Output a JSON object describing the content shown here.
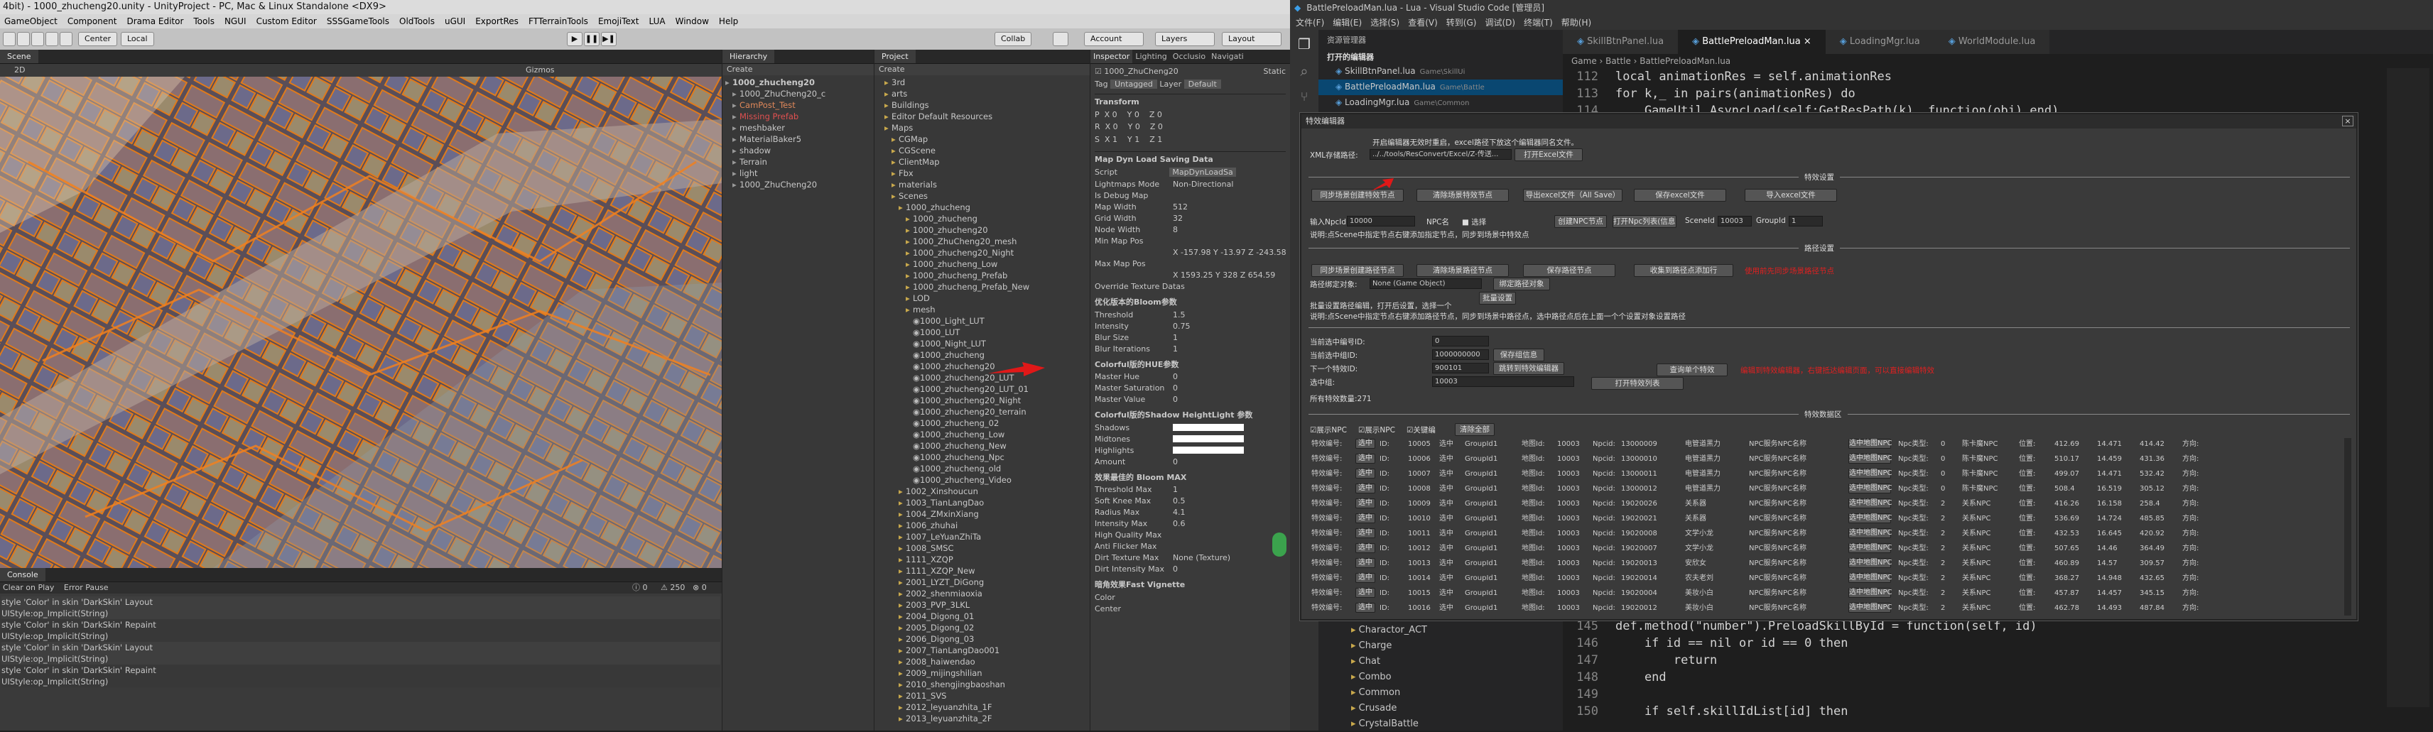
{
  "unity": {
    "title": "4bit) - 1000_zhucheng20.unity - UnityProject - PC, Mac & Linux Standalone <DX9>",
    "menu": [
      "GameObject",
      "Component",
      "Drama Editor",
      "Tools",
      "NGUI",
      "Custom Editor",
      "SSSGameTools",
      "OldTools",
      "uGUI",
      "ExportRes",
      "FTTerrainTools",
      "EmojiText",
      "LUA",
      "Window",
      "Help"
    ],
    "toolbar": {
      "center": "Center",
      "local": "Local",
      "collab": "Collab",
      "account": "Account",
      "layers": "Layers",
      "layout": "Layout"
    },
    "scene": {
      "tab": "Scene",
      "mode": "2D",
      "gizmos": "Gizmos"
    },
    "hierarchy": {
      "tab": "Hierarchy",
      "create": "Create",
      "items": [
        {
          "t": "1000_zhucheng20",
          "d": 0,
          "b": true
        },
        {
          "t": "1000_ZhuCheng20_c",
          "d": 1
        },
        {
          "t": "CamPost_Test",
          "d": 1,
          "c": "#e0885a"
        },
        {
          "t": "Missing Prefab",
          "d": 1,
          "c": "#e05050"
        },
        {
          "t": "meshbaker",
          "d": 1
        },
        {
          "t": "MaterialBaker5",
          "d": 1
        },
        {
          "t": "shadow",
          "d": 1
        },
        {
          "t": "Terrain",
          "d": 1
        },
        {
          "t": "light",
          "d": 1
        },
        {
          "t": "1000_ZhuCheng20",
          "d": 1
        }
      ]
    },
    "project": {
      "tab": "Project",
      "create": "Create",
      "items": [
        {
          "t": "3rd",
          "d": 1
        },
        {
          "t": "arts",
          "d": 1
        },
        {
          "t": "Buildings",
          "d": 1
        },
        {
          "t": "Editor Default Resources",
          "d": 1
        },
        {
          "t": "Maps",
          "d": 1
        },
        {
          "t": "CGMap",
          "d": 2
        },
        {
          "t": "CGScene",
          "d": 2
        },
        {
          "t": "ClientMap",
          "d": 2
        },
        {
          "t": "Fbx",
          "d": 2
        },
        {
          "t": "materials",
          "d": 2
        },
        {
          "t": "Scenes",
          "d": 2
        },
        {
          "t": "1000_zhucheng",
          "d": 3
        },
        {
          "t": "1000_zhucheng",
          "d": 4
        },
        {
          "t": "1000_zhucheng20",
          "d": 4
        },
        {
          "t": "1000_ZhuCheng20_mesh",
          "d": 4
        },
        {
          "t": "1000_zhucheng20_Night",
          "d": 4
        },
        {
          "t": "1000_zhucheng_Low",
          "d": 4
        },
        {
          "t": "1000_zhucheng_Prefab",
          "d": 4
        },
        {
          "t": "1000_zhucheng_Prefab_New",
          "d": 4
        },
        {
          "t": "LOD",
          "d": 4
        },
        {
          "t": "mesh",
          "d": 4
        },
        {
          "t": "1000_Light_LUT",
          "d": 5
        },
        {
          "t": "1000_LUT",
          "d": 5
        },
        {
          "t": "1000_Night_LUT",
          "d": 5
        },
        {
          "t": "1000_zhucheng",
          "d": 5
        },
        {
          "t": "1000_zhucheng20",
          "d": 5
        },
        {
          "t": "1000_zhucheng20_LUT",
          "d": 5
        },
        {
          "t": "1000_zhucheng20_LUT_01",
          "d": 5
        },
        {
          "t": "1000_zhucheng20_Night",
          "d": 5
        },
        {
          "t": "1000_zhucheng20_terrain",
          "d": 5
        },
        {
          "t": "1000_zhucheng_02",
          "d": 5
        },
        {
          "t": "1000_zhucheng_Low",
          "d": 5
        },
        {
          "t": "1000_zhucheng_New",
          "d": 5
        },
        {
          "t": "1000_zhucheng_Npc",
          "d": 5
        },
        {
          "t": "1000_zhucheng_old",
          "d": 5
        },
        {
          "t": "1000_zhucheng_Video",
          "d": 5
        },
        {
          "t": "1002_Xinshoucun",
          "d": 3
        },
        {
          "t": "1003_TianLangDao",
          "d": 3
        },
        {
          "t": "1004_ZMxinXiang",
          "d": 3
        },
        {
          "t": "1006_zhuhai",
          "d": 3
        },
        {
          "t": "1007_LeYuanZhiTa",
          "d": 3
        },
        {
          "t": "1008_SMSC",
          "d": 3
        },
        {
          "t": "1111_XZQP",
          "d": 3
        },
        {
          "t": "1111_XZQP_New",
          "d": 3
        },
        {
          "t": "2001_LYZT_DiGong",
          "d": 3
        },
        {
          "t": "2002_shenmiaoxia",
          "d": 3
        },
        {
          "t": "2003_PVP_3LKL",
          "d": 3
        },
        {
          "t": "2004_Digong_01",
          "d": 3
        },
        {
          "t": "2005_Digong_02",
          "d": 3
        },
        {
          "t": "2006_Digong_03",
          "d": 3
        },
        {
          "t": "2007_TianLangDao001",
          "d": 3
        },
        {
          "t": "2008_haiwendao",
          "d": 3
        },
        {
          "t": "2009_mijingshilian",
          "d": 3
        },
        {
          "t": "2010_shengjingbaoshan",
          "d": 3
        },
        {
          "t": "2011_SVS",
          "d": 3
        },
        {
          "t": "2012_leyuanzhita_1F",
          "d": 3
        },
        {
          "t": "2013_leyuanzhita_2F",
          "d": 3
        }
      ]
    },
    "inspector": {
      "tabs": [
        "Inspector",
        "Lighting",
        "Occlusio",
        "Navigati"
      ],
      "obj": "1000_ZhuCheng20",
      "static": "Static",
      "tag": "Untagged",
      "layer": "Default",
      "transform": "Transform",
      "pos": [
        "0",
        "0",
        "0"
      ],
      "rot": [
        "0",
        "0",
        "0"
      ],
      "scl": [
        "1",
        "1",
        "1"
      ],
      "mapdyn": "Map Dyn Load Saving Data",
      "script": "MapDynLoadSa",
      "rows": [
        [
          "Lightmaps Mode",
          "Non-Directional"
        ],
        [
          "Is Debug Map",
          ""
        ],
        [
          "Map Width",
          "512"
        ],
        [
          "Grid Width",
          "32"
        ],
        [
          "Node Width",
          "8"
        ],
        [
          "Min Map Pos",
          ""
        ],
        [
          "",
          "X -157.98   Y -13.97   Z -243.58"
        ],
        [
          "Max Map Pos",
          ""
        ],
        [
          "",
          "X 1593.25   Y 328   Z 654.59"
        ],
        [
          "Override Texture Datas",
          ""
        ]
      ],
      "bloom_title": "优化版本的Bloom参数",
      "bloom": [
        [
          "Threshold",
          "1.5"
        ],
        [
          "Intensity",
          "0.75"
        ],
        [
          "Blur Size",
          "1"
        ],
        [
          "Blur Iterations",
          "1"
        ]
      ],
      "hue_title": "Colorful版的HUE参数",
      "hue": [
        [
          "Master Hue",
          "0"
        ],
        [
          "Master Saturation",
          "0"
        ],
        [
          "Master Value",
          "0"
        ]
      ],
      "shadow_title": "Colorful版的Shadow HeightLight 参数",
      "shadow": [
        [
          "Shadows",
          ""
        ],
        [
          "Midtones",
          ""
        ],
        [
          "Highlights",
          ""
        ],
        [
          "Amount",
          "0"
        ]
      ],
      "bmax_title": "效果最佳的 Bloom MAX",
      "bmax": [
        [
          "Threshold Max",
          "1"
        ],
        [
          "Soft Knee Max",
          "0.5"
        ],
        [
          "Radius Max",
          "4.1"
        ],
        [
          "Intensity Max",
          "0.6"
        ],
        [
          "High Quality Max",
          ""
        ],
        [
          "Anti Flicker Max",
          ""
        ],
        [
          "Dirt Texture Max",
          "None (Texture)"
        ],
        [
          "Dirt Intensity Max",
          "0"
        ]
      ],
      "vig_title": "暗角效果Fast Vignette",
      "vig": [
        [
          "Color",
          ""
        ],
        [
          "Center",
          ""
        ]
      ]
    },
    "console": {
      "tab": "Console",
      "buttons": [
        "Clear on Play",
        "Error Pause"
      ],
      "counts": [
        "0",
        "250",
        "0"
      ],
      "lines": [
        "style 'Color' in skin 'DarkSkin' Layout",
        "UIStyle:op_Implicit(String)",
        "style 'Color' in skin 'DarkSkin' Repaint",
        "UIStyle:op_Implicit(String)",
        "style 'Color' in skin 'DarkSkin' Layout",
        "UIStyle:op_Implicit(String)",
        "style 'Color' in skin 'DarkSkin' Repaint",
        "UIStyle:op_Implicit(String)"
      ]
    }
  },
  "vscode": {
    "title": "BattlePreloadMan.lua - Lua - Visual Studio Code [管理员]",
    "menu": [
      "文件(F)",
      "编辑(E)",
      "选择(S)",
      "查看(V)",
      "转到(G)",
      "调试(D)",
      "终端(T)",
      "帮助(H)"
    ],
    "explorer": "资源管理器",
    "open_editors": "打开的编辑器",
    "open_files": [
      {
        "n": "SkillBtnPanel.lua",
        "p": "Game\\SkillUi"
      },
      {
        "n": "BattlePreloadMan.lua",
        "p": "Game\\Battle"
      },
      {
        "n": "LoadingMgr.lua",
        "p": "Game\\Common"
      }
    ],
    "tabs": [
      "SkillBtnPanel.lua",
      "BattlePreloadMan.lua",
      "LoadingMgr.lua",
      "WorldModule.lua"
    ],
    "breadcrumb": "Game › Battle › BattlePreloadMan.lua",
    "folders": [
      "Charactor_ACT",
      "Charge",
      "Chat",
      "Combo",
      "Common",
      "Crusade",
      "CrystalBattle"
    ],
    "code_top": [
      [
        "112",
        "local animationRes = self.animationRes"
      ],
      [
        "113",
        "for k,_ in pairs(animationRes) do"
      ],
      [
        "114",
        "    GameUtil.AsyncLoad(self:GetResPath(k), function(obj) end)"
      ]
    ],
    "code_bottom": [
      [
        "145",
        "def.method(\"number\").PreloadSkillById = function(self, id)"
      ],
      [
        "146",
        "    if id == nil or id == 0 then"
      ],
      [
        "147",
        "        return"
      ],
      [
        "148",
        "    end"
      ],
      [
        "149",
        ""
      ],
      [
        "150",
        "    if self.skillIdList[id] then"
      ]
    ]
  },
  "dialog": {
    "title": "特效编辑器",
    "note": "开启编辑器无效时重启，excel路径下放这个编辑器同名文件。",
    "xml_label": "XML存储路径:",
    "xml_path": "../../tools/ResConvert/Excel/Z-传送...",
    "open_excel": "打开Excel文件",
    "sec1": "特效设置",
    "btns1": [
      "同步场景创建特效节点",
      "清除场景特效节点",
      "导出excel文件（All Save）",
      "保存excel文件",
      "导入excel文件"
    ],
    "npc_label": "输入NpcId",
    "npc_val": "10000",
    "npc_name": "NPC名",
    "select": "选择",
    "create_npc": "创建NPC节点",
    "open_npc": "打开Npc列表(信息)",
    "scene_id_label": "SceneId",
    "scene_id": "10003",
    "group_label": "GroupId",
    "group_id": "1",
    "desc1": "说明:点Scene中指定节点右键添加指定节点，同步到场景中特效点",
    "sec2": "路径设置",
    "btns2": [
      "同步场景创建路径节点",
      "清除场景路径节点",
      "保存路径节点",
      "收集到路径点添加行"
    ],
    "red_note1": "使用前先同步场景路径节点",
    "target_label": "路径绑定对象:",
    "target_val": "None (Game Object)",
    "bind_btn": "绑定路径对象",
    "batch_btn": "批量设置",
    "desc_batch": "批量设置路径编辑，打开后设置，选择一个",
    "desc2": "说明:点Scene中指定节点右键添加路径节点，同步到场景中路径点，选中路径点后在上面一个个设置对象设置路径",
    "cur_id_label": "当前选中编号ID:",
    "cur_id": "0",
    "cur_grp_label": "当前选中组ID:",
    "cur_grp": "1000000000",
    "save_group": "保存组信息",
    "next_label": "下一个特效ID:",
    "next_id": "900101",
    "jump_btn": "跳转到特效编辑器",
    "query_btn": "查询单个特效",
    "red_note2": "编辑到特效编辑器，右键抵达编辑页面，可以直接编辑特效",
    "selected_label": "选中组:",
    "selected_val": "10003",
    "open_list": "打开特效列表",
    "count": "所有特效数量:271",
    "sec3": "特效数据区",
    "checks": [
      "展示NPC",
      "展示NPC",
      "关键编"
    ],
    "clear_btn": "清除全部",
    "rows": [
      [
        "10005",
        "1",
        "10003",
        "13000009",
        "电管道黑力",
        "NPC服务NPC名称",
        "0",
        "陈卡魔NPC",
        "412.69",
        "14.471",
        "414.42"
      ],
      [
        "10006",
        "1",
        "10003",
        "13000010",
        "电管道黑力",
        "NPC服务NPC名称",
        "0",
        "陈卡魔NPC",
        "510.17",
        "14.459",
        "431.36"
      ],
      [
        "10007",
        "1",
        "10003",
        "13000011",
        "电管道黑力",
        "NPC服务NPC名称",
        "0",
        "陈卡魔NPC",
        "499.07",
        "14.471",
        "532.42"
      ],
      [
        "10008",
        "1",
        "10003",
        "13000012",
        "电管道黑力",
        "NPC服务NPC名称",
        "0",
        "陈卡魔NPC",
        "508.4",
        "16.519",
        "305.12"
      ],
      [
        "10009",
        "1",
        "10003",
        "19020026",
        "关系器",
        "NPC服务NPC名称",
        "2",
        "关系NPC",
        "416.26",
        "16.158",
        "258.4"
      ],
      [
        "10010",
        "1",
        "10003",
        "19020021",
        "关系器",
        "NPC服务NPC名称",
        "2",
        "关系NPC",
        "536.69",
        "14.724",
        "485.85"
      ],
      [
        "10011",
        "1",
        "10003",
        "19020008",
        "文学小龙",
        "NPC服务NPC名称",
        "2",
        "关系NPC",
        "432.53",
        "16.645",
        "420.92"
      ],
      [
        "10012",
        "1",
        "10003",
        "19020007",
        "文学小龙",
        "NPC服务NPC名称",
        "2",
        "关系NPC",
        "507.65",
        "14.46",
        "364.49"
      ],
      [
        "10013",
        "1",
        "10003",
        "19020013",
        "安欣女",
        "NPC服务NPC名称",
        "2",
        "关系NPC",
        "460.89",
        "14.57",
        "309.57"
      ],
      [
        "10014",
        "1",
        "10003",
        "19020014",
        "农夫老刘",
        "NPC服务NPC名称",
        "2",
        "关系NPC",
        "368.27",
        "14.948",
        "432.65"
      ],
      [
        "10015",
        "1",
        "10003",
        "19020004",
        "美妆小白",
        "NPC服务NPC名称",
        "2",
        "关系NPC",
        "457.87",
        "14.457",
        "345.15"
      ],
      [
        "10016",
        "1",
        "10003",
        "19020012",
        "美妆小白",
        "NPC服务NPC名称",
        "2",
        "关系NPC",
        "462.78",
        "14.493",
        "487.84"
      ]
    ],
    "col": {
      "a": "特效编号:",
      "b": "选中",
      "c": "ID:",
      "d": "选中",
      "e": "GroupId",
      "f": "地图Id:",
      "g": "Npcid:",
      "h": "选中地图NPC",
      "i": "Npc类型:",
      "j": "位置:",
      "k": "方向:"
    }
  }
}
